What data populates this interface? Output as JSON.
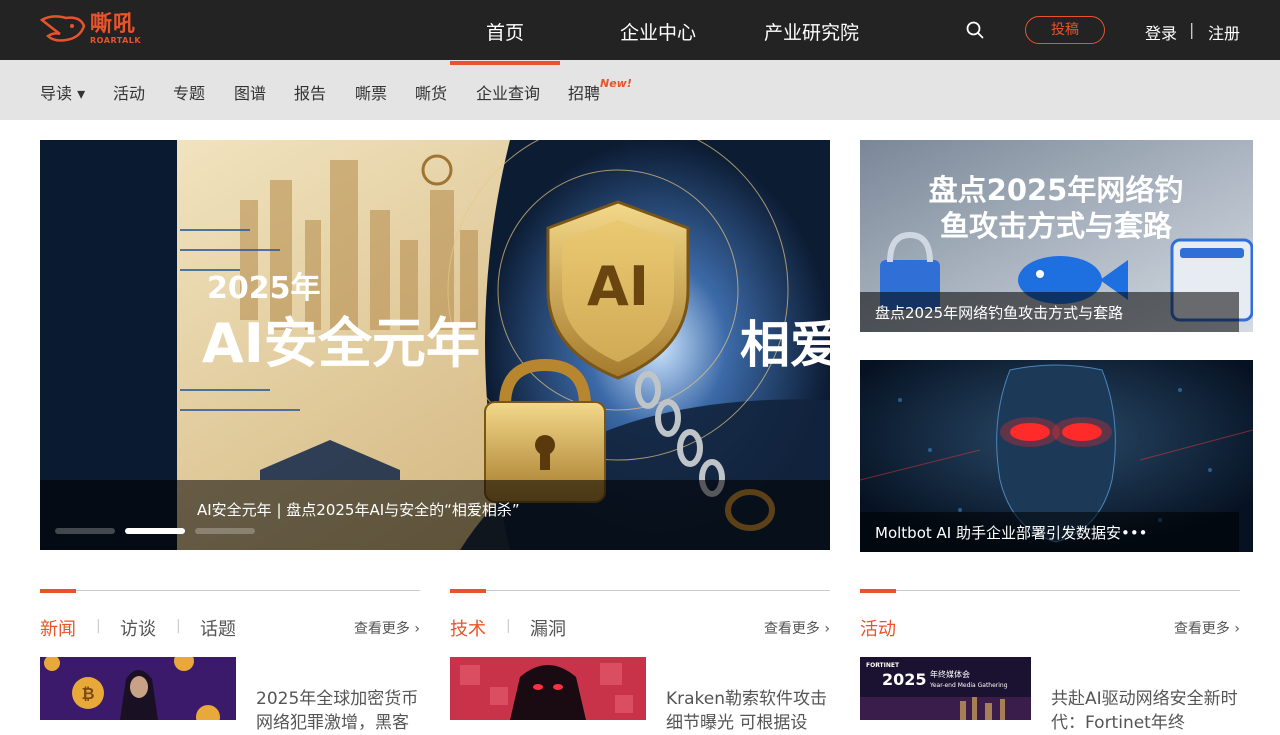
{
  "brand": {
    "name_cn": "嘶吼",
    "name_en": "ROARTALK",
    "accent": "#e8542a"
  },
  "main_nav": [
    "首页",
    "企业中心",
    "产业研究院"
  ],
  "header": {
    "submit_label": "投稿",
    "login_label": "登录",
    "divider": "|",
    "register_label": "注册"
  },
  "sub_nav": {
    "items": [
      "导读 ▾",
      "活动",
      "专题",
      "图谱",
      "报告",
      "嘶票",
      "嘶货",
      "企业查询",
      "招聘"
    ],
    "new_badge": "New!"
  },
  "hero": {
    "year_text": "2025年",
    "headline": "AI安全元年",
    "side_text": "相爱",
    "shield_text": "AI",
    "caption": "AI安全元年 | 盘点2025年AI与安全的“相爱相杀”",
    "slides_total": 3,
    "active_slide": 2
  },
  "side_cards": [
    {
      "image_title_line1": "盘点2025年网络钓",
      "image_title_line2": "鱼攻击方式与套路",
      "caption": "盘点2025年网络钓鱼攻击方式与套路"
    },
    {
      "caption": "Moltbot AI 助手企业部署引发数据安•••"
    }
  ],
  "sections": [
    {
      "tabs": [
        "新闻",
        "访谈",
        "话题"
      ],
      "separator": "|",
      "more": "查看更多 ›",
      "title": "2025年全球加密货币网络犯罪激增，黑客"
    },
    {
      "tabs": [
        "技术",
        "漏洞"
      ],
      "separator": "|",
      "more": "查看更多 ›",
      "title": "Kraken勒索软件攻击细节曝光 可根据设"
    },
    {
      "tabs": [
        "活动"
      ],
      "more": "查看更多 ›",
      "title": "共赴AI驱动网络安全新时代：Fortinet年终",
      "thumb_year": "2025",
      "thumb_cn": "年终媒体会",
      "thumb_en": "Year-end Media Gathering",
      "thumb_brand": "FORTINET"
    }
  ]
}
